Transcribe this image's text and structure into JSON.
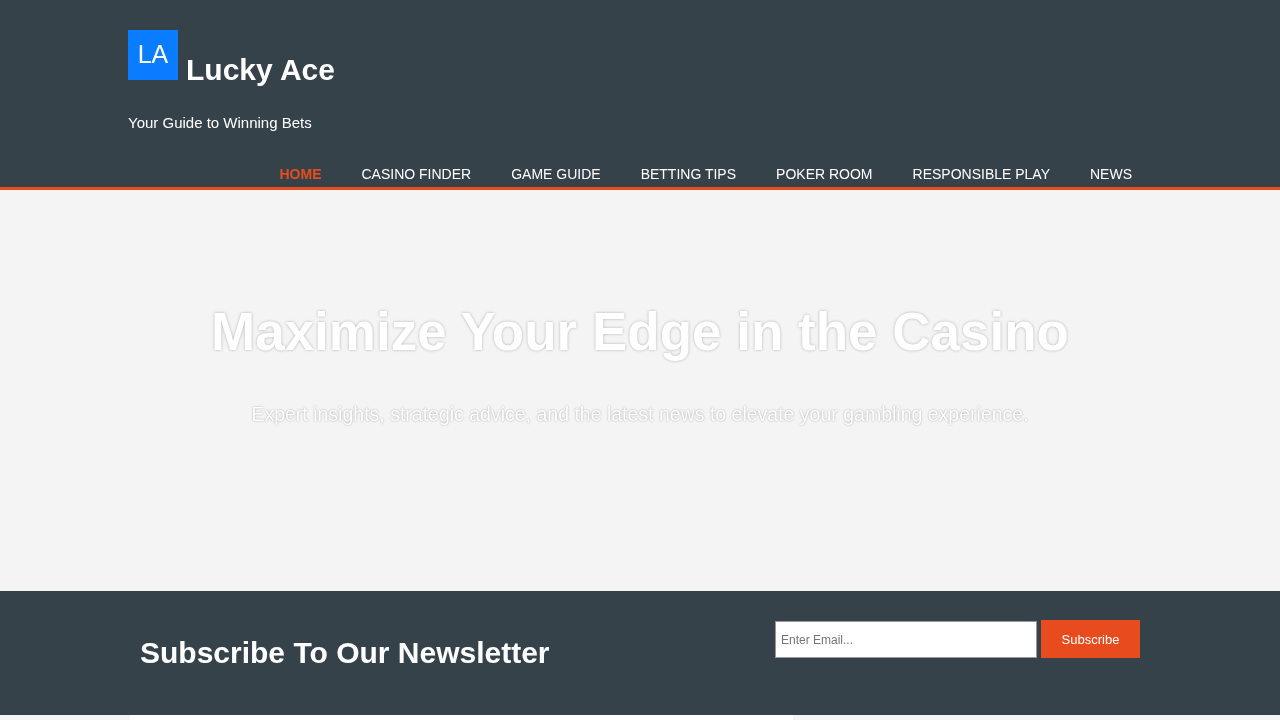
{
  "header": {
    "logo": {
      "mark": "LA",
      "name": "Lucky Ace"
    },
    "tagline": "Your Guide to Winning Bets",
    "nav": [
      {
        "label": "HOME",
        "selected": true
      },
      {
        "label": "CASINO FINDER",
        "selected": false
      },
      {
        "label": "GAME GUIDE",
        "selected": false
      },
      {
        "label": "BETTING TIPS",
        "selected": false
      },
      {
        "label": "POKER ROOM",
        "selected": false
      },
      {
        "label": "RESPONSIBLE PLAY",
        "selected": false
      },
      {
        "label": "NEWS",
        "selected": false
      }
    ]
  },
  "hero": {
    "title": "Maximize Your Edge in the Casino",
    "subtitle": "Expert insights, strategic advice, and the latest news to elevate your gambling experience."
  },
  "newsletter": {
    "title": "Subscribe To Our Newsletter",
    "email": {
      "placeholder": "Enter Email..."
    },
    "button": "Subscribe"
  }
}
